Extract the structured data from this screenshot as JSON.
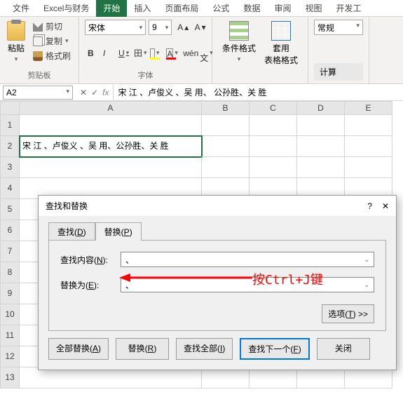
{
  "tabs": {
    "file": "文件",
    "custom": "Excel与财务",
    "home": "开始",
    "insert": "插入",
    "layout": "页面布局",
    "formula": "公式",
    "data": "数据",
    "review": "审阅",
    "view": "视图",
    "dev": "开发工"
  },
  "ribbon": {
    "paste": "粘贴",
    "cut": "剪切",
    "copy": "复制",
    "brush": "格式刷",
    "clip_label": "剪贴板",
    "font_name": "宋体",
    "font_size": "9",
    "font_label": "字体",
    "cf": "条件格式",
    "tbl": "套用\n表格格式",
    "num_format": "常规",
    "calc": "计算"
  },
  "namebox": "A2",
  "formula": "宋 江 、卢俊义 、吴 用、 公孙胜、关  胜",
  "cols": {
    "A": 260,
    "B": 68,
    "C": 68,
    "D": 68,
    "E": 68
  },
  "rows": [
    "1",
    "2",
    "3",
    "4",
    "5",
    "6",
    "7",
    "8",
    "9",
    "10",
    "11",
    "12",
    "13"
  ],
  "cellA2": "宋  江 、卢俊义 、吴    用、公孙胜、关    胜",
  "dialog": {
    "title": "查找和替换",
    "tab_find": "查找(D)",
    "tab_replace": "替换(P)",
    "find_label": "查找内容(N):",
    "find_value": "、",
    "replace_label": "替换为(E):",
    "replace_value": "、",
    "options": "选项(T) >>",
    "btn_replace_all": "全部替换(A)",
    "btn_replace": "替换(R)",
    "btn_find_all": "查找全部(I)",
    "btn_find_next": "查找下一个(F)",
    "btn_close": "关闭"
  },
  "annotation": "按Ctrl+J键"
}
